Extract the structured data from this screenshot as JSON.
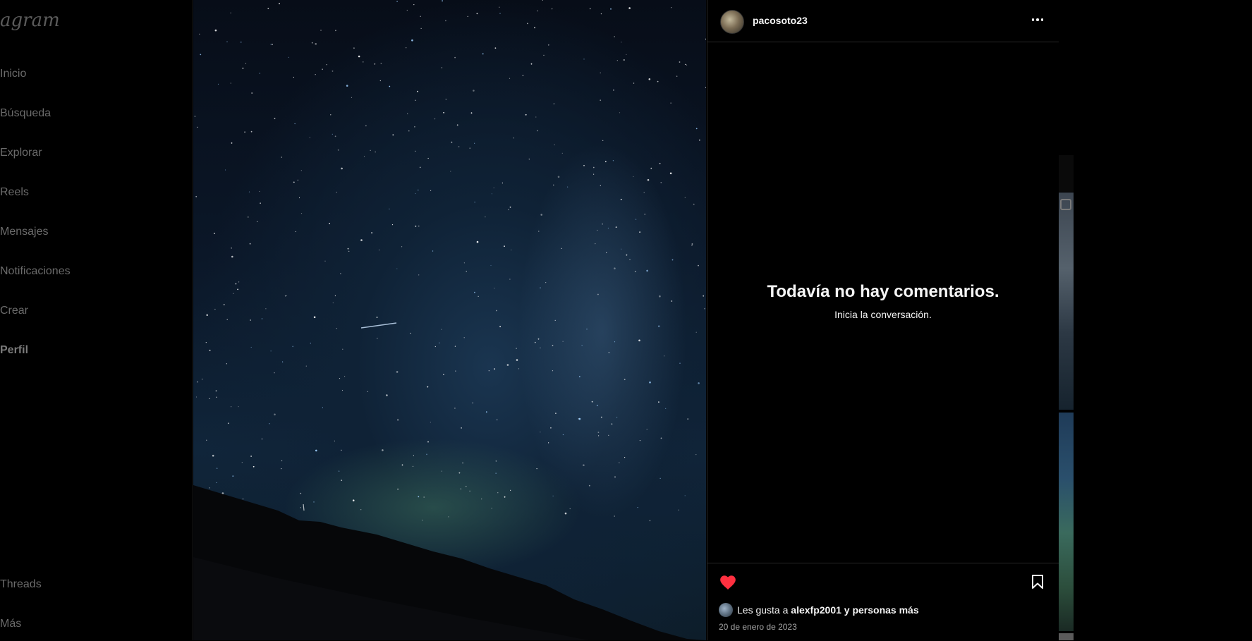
{
  "sidebar": {
    "logo": "agram",
    "items": [
      {
        "label": "Inicio",
        "icon": "home-icon"
      },
      {
        "label": "Búsqueda",
        "icon": "search-icon"
      },
      {
        "label": "Explorar",
        "icon": "explore-icon"
      },
      {
        "label": "Reels",
        "icon": "reels-icon"
      },
      {
        "label": "Mensajes",
        "icon": "messages-icon"
      },
      {
        "label": "Notificaciones",
        "icon": "heart-icon"
      },
      {
        "label": "Crear",
        "icon": "plus-icon"
      },
      {
        "label": "Perfil",
        "icon": "avatar"
      }
    ],
    "bottom_items": [
      {
        "label": "Threads",
        "icon": "threads-icon"
      },
      {
        "label": "Más",
        "icon": "menu-icon"
      }
    ]
  },
  "post": {
    "image_alt": "Night sky with Milky Way over a dark hillside",
    "author": "pacosoto23",
    "more_icon": "more-options-icon",
    "comments": {
      "empty_title": "Todavía no hay comentarios.",
      "empty_subtitle": "Inicia la conversación."
    },
    "liked": true,
    "like_color": "#ff3040",
    "likes_prefix": "Les gusta a",
    "liker": "alexfp2001",
    "likes_suffix": "y personas más",
    "date": "20 de enero de 2023"
  }
}
